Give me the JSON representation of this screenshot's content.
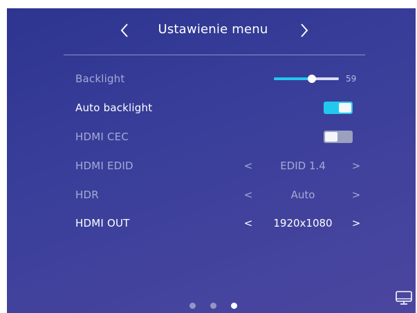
{
  "header": {
    "title": "Ustawienie menu",
    "prev_icon": "chevron-left-icon",
    "next_icon": "chevron-right-icon"
  },
  "rows": {
    "backlight": {
      "label": "Backlight",
      "value": "59",
      "level": 59
    },
    "auto_backlight": {
      "label": "Auto backlight",
      "toggle": "on"
    },
    "hdmi_cec": {
      "label": "HDMI CEC",
      "toggle": "off"
    },
    "hdmi_edid": {
      "label": "HDMI EDID",
      "value": "EDID 1.4",
      "prev": "<",
      "next": ">"
    },
    "hdr": {
      "label": "HDR",
      "value": "Auto",
      "prev": "<",
      "next": ">"
    },
    "hdmi_out": {
      "label": "HDMI OUT",
      "value": "1920x1080",
      "prev": "<",
      "next": ">"
    }
  },
  "pager": {
    "pages": 3,
    "active": 3
  },
  "footer": {
    "monitor_icon": "monitor-icon"
  },
  "colors": {
    "accent": "#22c9ef",
    "background": "#3a3f9a",
    "dim_text": "#a6aad6"
  }
}
